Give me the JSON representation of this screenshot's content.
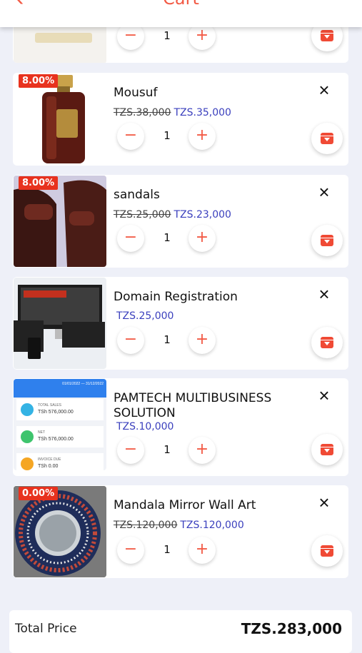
{
  "header": {
    "title": "Cart",
    "back_icon": "chevron-left-icon"
  },
  "colors": {
    "accent": "#f25a45",
    "price": "#3a3fbd",
    "badge": "#e8321e",
    "background": "#eef0f8"
  },
  "stepper": {
    "minus": "−",
    "plus": "+"
  },
  "items": [
    {
      "name": "",
      "old_price": "",
      "new_price": "",
      "qty": "1",
      "discount": ""
    },
    {
      "name": "Mousuf",
      "old_price": "TZS.38,000",
      "new_price": "TZS.35,000",
      "qty": "1",
      "discount": "8.00%"
    },
    {
      "name": "sandals",
      "old_price": "TZS.25,000",
      "new_price": "TZS.23,000",
      "qty": "1",
      "discount": "8.00%"
    },
    {
      "name": "Domain Registration",
      "old_price": "",
      "new_price": "TZS.25,000",
      "qty": "1",
      "discount": ""
    },
    {
      "name": "PAMTECH MULTIBUSINESS SOLUTION",
      "old_price": "",
      "new_price": "TZS.10,000",
      "qty": "1",
      "discount": "",
      "thumb": {
        "date_range": "01/01/2022 — 31/12/2022",
        "stats": [
          {
            "label": "TOTAL SALES",
            "value": "TSh 576,000.00"
          },
          {
            "label": "NET",
            "value": "TSh 576,000.00"
          },
          {
            "label": "INVOICE DUE",
            "value": "TSh 0.00"
          }
        ]
      }
    },
    {
      "name": "Mandala Mirror Wall Art",
      "old_price": "TZS.120,000",
      "new_price": "TZS.120,000",
      "qty": "1",
      "discount": "0.00%"
    }
  ],
  "summary": {
    "label": "Total Price",
    "value": "TZS.283,000"
  }
}
